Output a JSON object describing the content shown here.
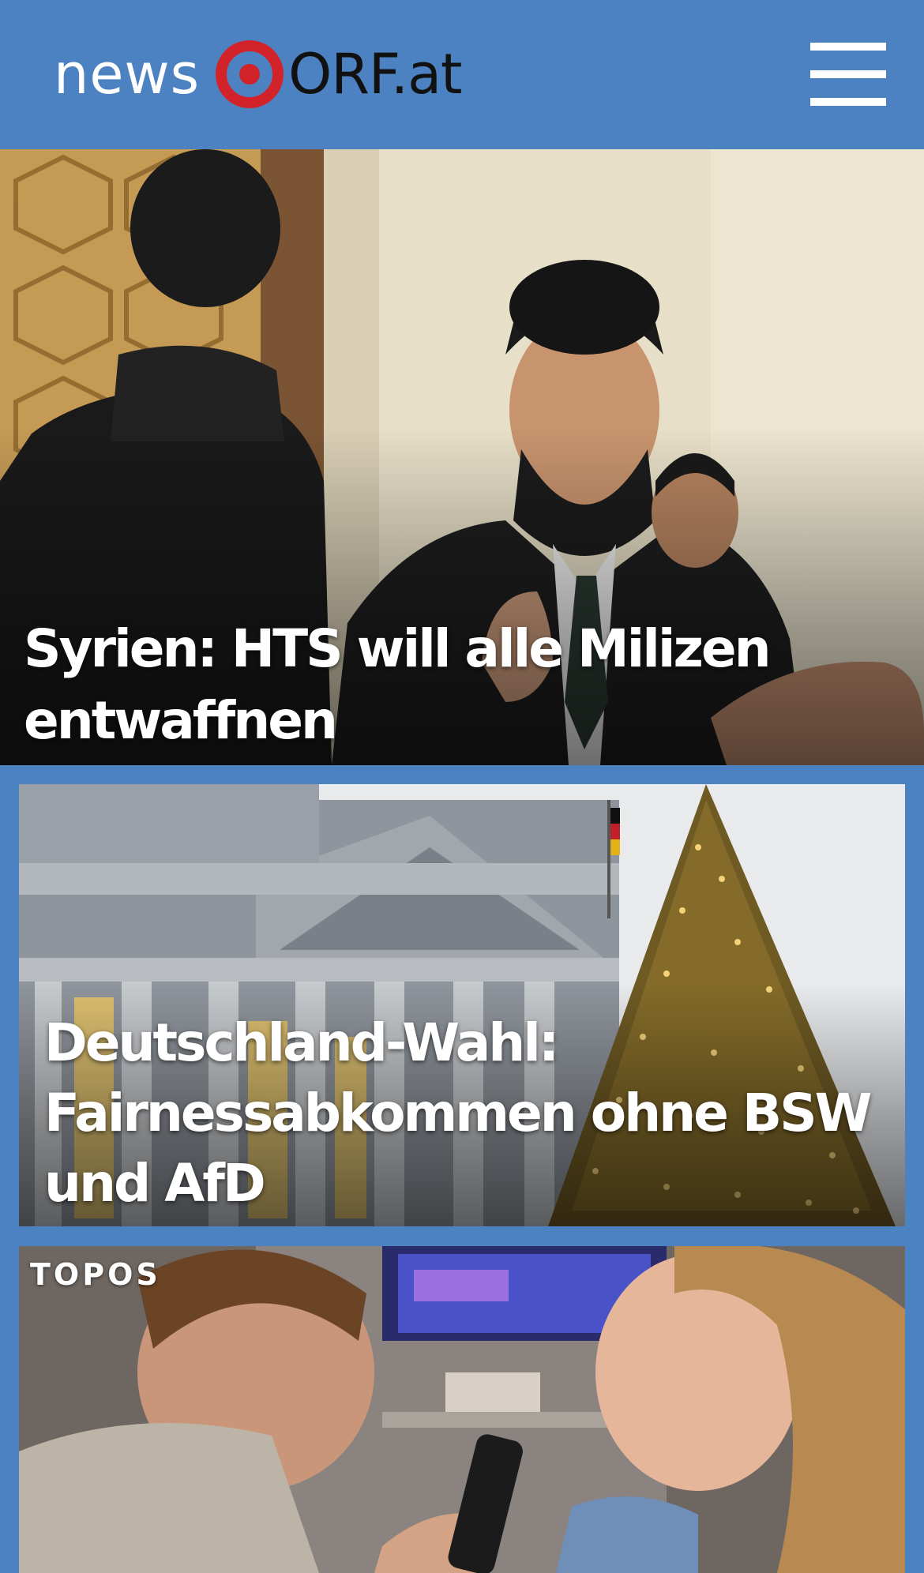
{
  "header": {
    "logo_news": "news",
    "logo_orf": "ORF.at",
    "background": "#4c82c1",
    "logo_mark_color": "#d2232a"
  },
  "icons": {
    "menu": "hamburger-menu-icon",
    "logo": "orf-eye-logo-icon"
  },
  "articles": [
    {
      "headline": "Syrien: HTS will alle Milizen entwaffnen",
      "image": "man-in-suit-with-beard-gesturing-photo"
    },
    {
      "headline": "Deutschland-Wahl: Fairnessabkommen ohne BSW und AfD",
      "image": "reichstag-building-with-christmas-tree-photo"
    },
    {
      "section": "TOPOS",
      "image": "couple-watching-tv-with-remote-photo"
    }
  ]
}
